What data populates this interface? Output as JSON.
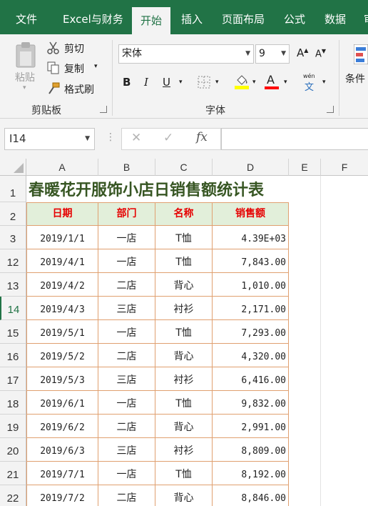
{
  "ribbon_tabs": [
    "文件",
    "Excel与财务",
    "开始",
    "插入",
    "页面布局",
    "公式",
    "数据",
    "审"
  ],
  "active_tab": "开始",
  "clipboard": {
    "paste_label": "粘贴",
    "cut_label": "剪切",
    "copy_label": "复制",
    "format_painter_label": "格式刷",
    "group_label": "剪贴板"
  },
  "font": {
    "font_name": "宋体",
    "font_size": "9",
    "bold_label": "B",
    "italic_label": "I",
    "underline_label": "U",
    "font_color_label": "A",
    "phonetic_label": "wén",
    "phonetic_char": "文",
    "grow_label": "A",
    "shrink_label": "A",
    "group_label": "字体",
    "fill_color": "#ffff00",
    "font_color": "#ff0000"
  },
  "styles": {
    "conditional_label": "条件"
  },
  "formula_bar": {
    "name_box": "I14",
    "cancel_icon": "✕",
    "enter_icon": "✓",
    "fx_label": "fx",
    "formula": ""
  },
  "columns": [
    "A",
    "B",
    "C",
    "D",
    "E",
    "F"
  ],
  "sheet": {
    "title_row": "1",
    "title": "春暖花开服饰小店日销售额统计表",
    "header_row": "2",
    "headers": [
      "日期",
      "部门",
      "名称",
      "销售额"
    ],
    "rows": [
      {
        "row": "3",
        "date": "2019/1/1",
        "dept": "一店",
        "item": "T恤",
        "sales": "4.39E+03"
      },
      {
        "row": "12",
        "date": "2019/4/1",
        "dept": "一店",
        "item": "T恤",
        "sales": "7,843.00"
      },
      {
        "row": "13",
        "date": "2019/4/2",
        "dept": "二店",
        "item": "背心",
        "sales": "1,010.00"
      },
      {
        "row": "14",
        "date": "2019/4/3",
        "dept": "三店",
        "item": "衬衫",
        "sales": "2,171.00"
      },
      {
        "row": "15",
        "date": "2019/5/1",
        "dept": "一店",
        "item": "T恤",
        "sales": "7,293.00"
      },
      {
        "row": "16",
        "date": "2019/5/2",
        "dept": "二店",
        "item": "背心",
        "sales": "4,320.00"
      },
      {
        "row": "17",
        "date": "2019/5/3",
        "dept": "三店",
        "item": "衬衫",
        "sales": "6,416.00"
      },
      {
        "row": "18",
        "date": "2019/6/1",
        "dept": "一店",
        "item": "T恤",
        "sales": "9,832.00"
      },
      {
        "row": "19",
        "date": "2019/6/2",
        "dept": "二店",
        "item": "背心",
        "sales": "2,991.00"
      },
      {
        "row": "20",
        "date": "2019/6/3",
        "dept": "三店",
        "item": "衬衫",
        "sales": "8,809.00"
      },
      {
        "row": "21",
        "date": "2019/7/1",
        "dept": "一店",
        "item": "T恤",
        "sales": "8,192.00"
      },
      {
        "row": "22",
        "date": "2019/7/2",
        "dept": "二店",
        "item": "背心",
        "sales": "8,846.00"
      }
    ]
  },
  "selected_row": "14",
  "colors": {
    "ribbon_green": "#217346",
    "header_fill": "#e2efda",
    "header_text": "#e60000",
    "title_text": "#375623",
    "table_border": "#e0a070"
  }
}
